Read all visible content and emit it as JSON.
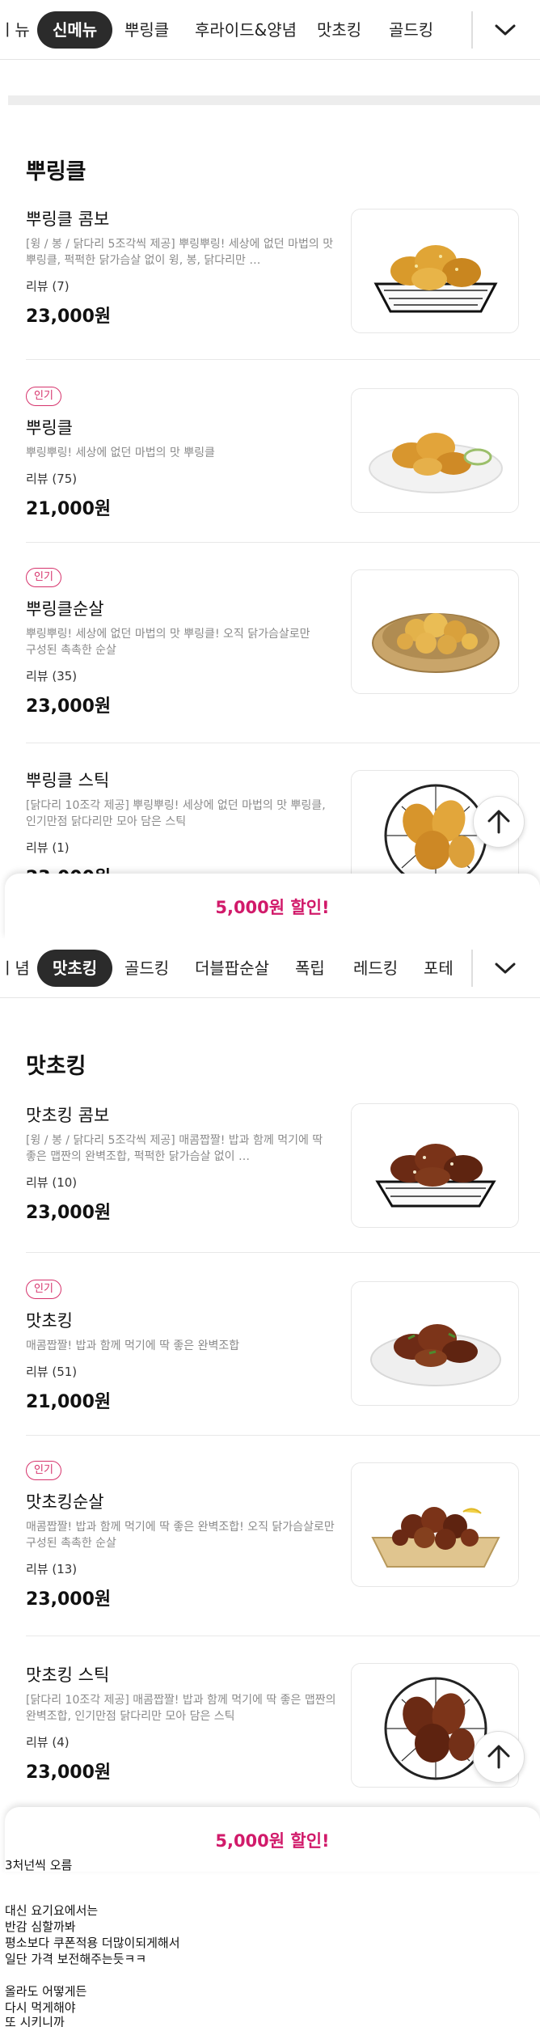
{
  "top_tabs": [
    "ㅣ뉴",
    "신메뉴",
    "뿌링클",
    "후라이드&양념",
    "맛초킹",
    "골드킹"
  ],
  "top_active": "신메뉴",
  "bottom_tabs": [
    "ㅣ념",
    "맛초킹",
    "골드킹",
    "더블팝순살",
    "폭립",
    "레드킹",
    "포테"
  ],
  "bottom_active": "맛초킹",
  "icons": {
    "toggle": "chevron-down-icon",
    "scroll_top": "arrow-up-icon"
  },
  "colors": {
    "accent": "#d11a6a",
    "badge": "#d6336c",
    "active_tab": "#2b2b2b"
  },
  "sections": [
    {
      "title": "뿌링클",
      "items": [
        {
          "badge": "",
          "name": "뿌링클 콤보",
          "desc": "[윙 / 봉 / 닭다리 5조각씩 제공] 뿌링뿌링! 세상에 없던 마법의 맛 뿌링클, 퍽퍽한 닭가슴살 없이 윙, 봉, 닭다리만 …",
          "reviews": "리뷰 (7)",
          "price": "23,000원"
        },
        {
          "badge": "인기",
          "name": "뿌링클",
          "desc": "뿌링뿌링! 세상에 없던 마법의 맛 뿌링클",
          "reviews": "리뷰 (75)",
          "price": "21,000원"
        },
        {
          "badge": "인기",
          "name": "뿌링클순살",
          "desc": "뿌링뿌링! 세상에 없던 마법의 맛 뿌링클! 오직 닭가슴살로만 구성된 촉촉한 순살",
          "reviews": "리뷰 (35)",
          "price": "23,000원"
        },
        {
          "badge": "",
          "name": "뿌링클 스틱",
          "desc": "[닭다리 10조각 제공] 뿌링뿌링! 세상에 없던 마법의 맛 뿌링클, 인기만점 닭다리만 모아 담은 스틱",
          "reviews": "리뷰 (1)",
          "price": "23,000원"
        }
      ]
    },
    {
      "title": "맛초킹",
      "items": [
        {
          "badge": "",
          "name": "맛초킹 콤보",
          "desc": "[윙 / 봉 / 닭다리 5조각씩 제공] 매콤짭짤! 밥과 함께 먹기에 딱 좋은 맵짠의 완벽조합, 퍽퍽한 닭가슴살 없이 …",
          "reviews": "리뷰 (10)",
          "price": "23,000원"
        },
        {
          "badge": "인기",
          "name": "맛초킹",
          "desc": "매콤짭짤! 밥과 함께 먹기에 딱 좋은 완벽조합",
          "reviews": "리뷰 (51)",
          "price": "21,000원"
        },
        {
          "badge": "인기",
          "name": "맛초킹순살",
          "desc": "매콤짭짤! 밥과 함께 먹기에 딱 좋은 완벽조합! 오직 닭가슴살로만 구성된 촉촉한 순살",
          "reviews": "리뷰 (13)",
          "price": "23,000원"
        },
        {
          "badge": "",
          "name": "맛초킹 스틱",
          "desc": "[닭다리 10조각 제공] 매콤짭짤! 밥과 함께 먹기에 딱 좋은 맵짠의 완벽조합, 인기만점 닭다리만 모아 담은 스틱",
          "reviews": "리뷰 (4)",
          "price": "23,000원"
        }
      ]
    }
  ],
  "discount_label": "5,000원 할인!",
  "comment_lines": [
    "3처넌씩 오름",
    "",
    "대신 요기요에서는",
    "반감 심할까봐",
    "평소보다 쿠폰적용 더많이되게해서",
    "일단 가격 보전해주는듯ㅋㅋ",
    "",
    "올라도 어떻게든",
    "다시 먹게해야",
    "또 시키니까"
  ]
}
